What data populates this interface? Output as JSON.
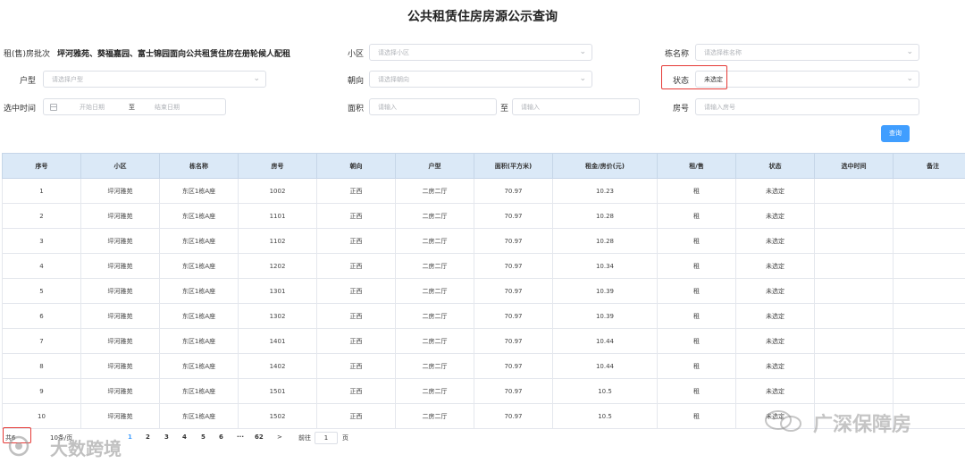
{
  "title": "公共租赁住房房源公示查询",
  "form": {
    "batch_label": "租(售)房批次",
    "batch_value": "坪河雅苑、葵福嘉园、富士锦园面向公共租赁住房在册轮候人配租",
    "community_label": "小区",
    "community_placeholder": "请选择小区",
    "building_label": "栋名称",
    "building_placeholder": "请选择栋名称",
    "layout_label": "户型",
    "layout_placeholder": "请选择户型",
    "orientation_label": "朝向",
    "orientation_placeholder": "请选择朝向",
    "status_label": "状态",
    "status_value": "未选定",
    "time_label": "选中时间",
    "start_placeholder": "开始日期",
    "range_sep": "至",
    "end_placeholder": "结束日期",
    "area_label": "面积",
    "area_min_placeholder": "请输入",
    "area_sep": "至",
    "area_max_placeholder": "请输入",
    "room_label": "房号",
    "room_placeholder": "请输入房号",
    "search_button": "查询"
  },
  "table": {
    "columns": [
      "序号",
      "小区",
      "栋名称",
      "房号",
      "朝向",
      "户型",
      "面积(平方米)",
      "租金/房价(元)",
      "租/售",
      "状态",
      "选中时间",
      "备注"
    ],
    "rows": [
      [
        "1",
        "坪河雅苑",
        "东区1栋A座",
        "1002",
        "正西",
        "二房二厅",
        "70.97",
        "10.23",
        "租",
        "未选定",
        "",
        ""
      ],
      [
        "2",
        "坪河雅苑",
        "东区1栋A座",
        "1101",
        "正西",
        "二房二厅",
        "70.97",
        "10.28",
        "租",
        "未选定",
        "",
        ""
      ],
      [
        "3",
        "坪河雅苑",
        "东区1栋A座",
        "1102",
        "正西",
        "二房二厅",
        "70.97",
        "10.28",
        "租",
        "未选定",
        "",
        ""
      ],
      [
        "4",
        "坪河雅苑",
        "东区1栋A座",
        "1202",
        "正西",
        "二房二厅",
        "70.97",
        "10.34",
        "租",
        "未选定",
        "",
        ""
      ],
      [
        "5",
        "坪河雅苑",
        "东区1栋A座",
        "1301",
        "正西",
        "二房二厅",
        "70.97",
        "10.39",
        "租",
        "未选定",
        "",
        ""
      ],
      [
        "6",
        "坪河雅苑",
        "东区1栋A座",
        "1302",
        "正西",
        "二房二厅",
        "70.97",
        "10.39",
        "租",
        "未选定",
        "",
        ""
      ],
      [
        "7",
        "坪河雅苑",
        "东区1栋A座",
        "1401",
        "正西",
        "二房二厅",
        "70.97",
        "10.44",
        "租",
        "未选定",
        "",
        ""
      ],
      [
        "8",
        "坪河雅苑",
        "东区1栋A座",
        "1402",
        "正西",
        "二房二厅",
        "70.97",
        "10.44",
        "租",
        "未选定",
        "",
        ""
      ],
      [
        "9",
        "坪河雅苑",
        "东区1栋A座",
        "1501",
        "正西",
        "二房二厅",
        "70.97",
        "10.5",
        "租",
        "未选定",
        "",
        ""
      ],
      [
        "10",
        "坪河雅苑",
        "东区1栋A座",
        "1502",
        "正西",
        "二房二厅",
        "70.97",
        "10.5",
        "租",
        "未选定",
        "",
        ""
      ]
    ]
  },
  "pagination": {
    "total_text": "共6",
    "page_size": "10条/页",
    "pages": [
      "1",
      "2",
      "3",
      "4",
      "5",
      "6",
      "62"
    ],
    "ellipsis": "···",
    "next": ">",
    "goto_label": "前往",
    "goto_value": "1",
    "goto_unit": "页"
  },
  "watermarks": {
    "right": "广深保障房",
    "left": "大数跨境"
  },
  "colors": {
    "accent": "#409eff",
    "header_bg": "#dbe9f7",
    "highlight": "#e53935"
  }
}
